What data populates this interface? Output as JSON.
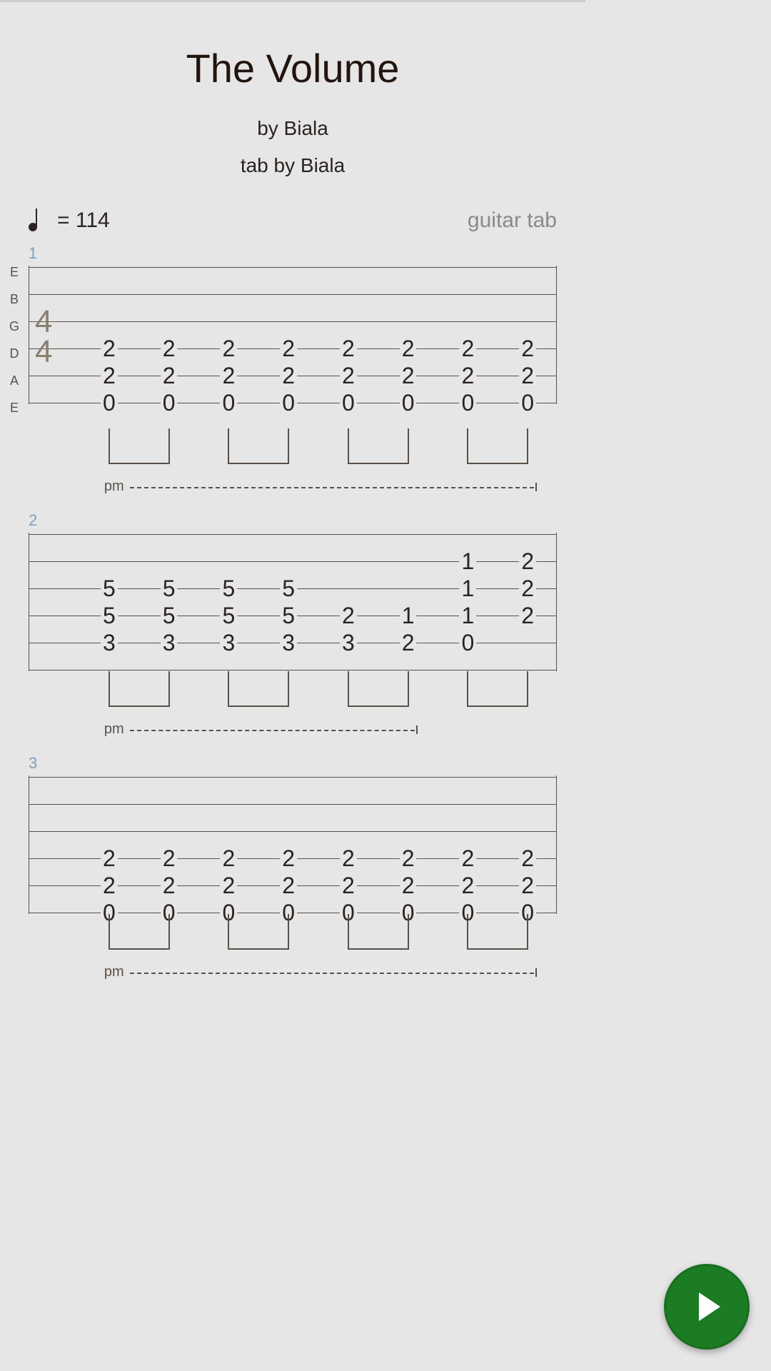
{
  "header": {
    "title": "The Volume",
    "artist_prefix": "by",
    "artist": "Biala",
    "tab_prefix": "tab by",
    "tabber": "Biala"
  },
  "tempo": {
    "value": "= 114"
  },
  "instrument": "guitar tab",
  "strings": [
    "E",
    "B",
    "G",
    "D",
    "A",
    "E"
  ],
  "timesig": {
    "top": "4",
    "bottom": "4"
  },
  "palm_mute_label": "pm",
  "measures": [
    {
      "num": "1",
      "show_labels": true,
      "show_timesig": true,
      "pm_end_col": 8,
      "columns": [
        {
          "D": "2",
          "A": "2",
          "E": "0"
        },
        {
          "D": "2",
          "A": "2",
          "E": "0"
        },
        {
          "D": "2",
          "A": "2",
          "E": "0"
        },
        {
          "D": "2",
          "A": "2",
          "E": "0"
        },
        {
          "D": "2",
          "A": "2",
          "E": "0"
        },
        {
          "D": "2",
          "A": "2",
          "E": "0"
        },
        {
          "D": "2",
          "A": "2",
          "E": "0"
        },
        {
          "D": "2",
          "A": "2",
          "E": "0"
        }
      ]
    },
    {
      "num": "2",
      "show_labels": false,
      "show_timesig": false,
      "pm_end_col": 6,
      "columns": [
        {
          "G": "5",
          "D": "5",
          "A": "3"
        },
        {
          "G": "5",
          "D": "5",
          "A": "3"
        },
        {
          "G": "5",
          "D": "5",
          "A": "3"
        },
        {
          "G": "5",
          "D": "5",
          "A": "3"
        },
        {
          "D": "2",
          "A": "3"
        },
        {
          "D": "1",
          "A": "2"
        },
        {
          "B": "1",
          "G": "1",
          "D": "1",
          "A": "0"
        },
        {
          "B": "2",
          "G": "2",
          "D": "2"
        }
      ]
    },
    {
      "num": "3",
      "show_labels": false,
      "show_timesig": false,
      "pm_end_col": 8,
      "columns": [
        {
          "D": "2",
          "A": "2",
          "E": "0"
        },
        {
          "D": "2",
          "A": "2",
          "E": "0"
        },
        {
          "D": "2",
          "A": "2",
          "E": "0"
        },
        {
          "D": "2",
          "A": "2",
          "E": "0"
        },
        {
          "D": "2",
          "A": "2",
          "E": "0"
        },
        {
          "D": "2",
          "A": "2",
          "E": "0"
        },
        {
          "D": "2",
          "A": "2",
          "E": "0"
        },
        {
          "D": "2",
          "A": "2",
          "E": "0"
        }
      ]
    }
  ],
  "actions": {
    "play_name": "play-button"
  }
}
